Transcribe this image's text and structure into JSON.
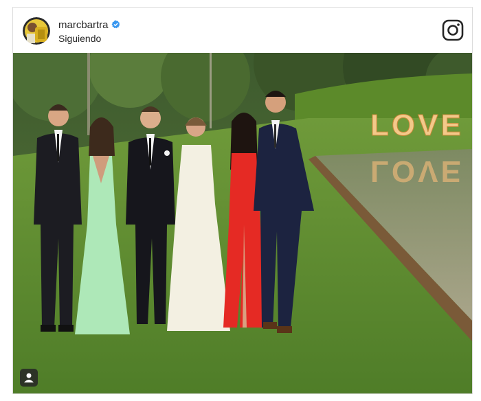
{
  "post": {
    "username": "marcbartra",
    "status": "Siguiendo"
  },
  "photo": {
    "sign_text": "LOVE",
    "sign_reflection": "LOVE"
  },
  "colors": {
    "text": "#262626",
    "verified": "#3897f0",
    "sign": "#f3c98a"
  },
  "icons": {
    "verified": "verified-badge-icon",
    "instagram": "instagram-icon",
    "tag": "user-tag-icon"
  }
}
